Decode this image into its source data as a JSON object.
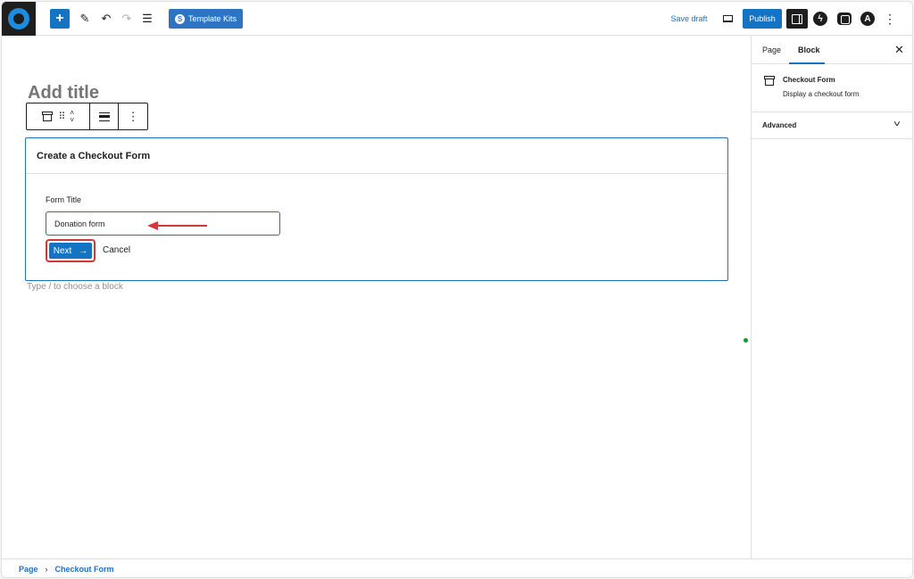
{
  "toolbar": {
    "template_kits_label": "Template Kits",
    "template_kits_icon": "S",
    "save_draft_label": "Save draft",
    "publish_label": "Publish"
  },
  "editor": {
    "title_placeholder": "Add title",
    "block_hint": "Type / to choose a block"
  },
  "checkout_form": {
    "header": "Create a Checkout Form",
    "field_label": "Form Title",
    "field_value": "Donation form",
    "next_label": "Next",
    "next_icon": "→",
    "cancel_label": "Cancel"
  },
  "sidebar": {
    "tabs": [
      "Page",
      "Block"
    ],
    "active_tab": "Block",
    "block_name": "Checkout Form",
    "block_description": "Display a checkout form",
    "advanced_label": "Advanced"
  },
  "breadcrumb": {
    "items": [
      "Page",
      "Checkout Form"
    ],
    "separator": "›"
  },
  "colors": {
    "accent": "#1573c3",
    "highlight": "#d63638"
  }
}
